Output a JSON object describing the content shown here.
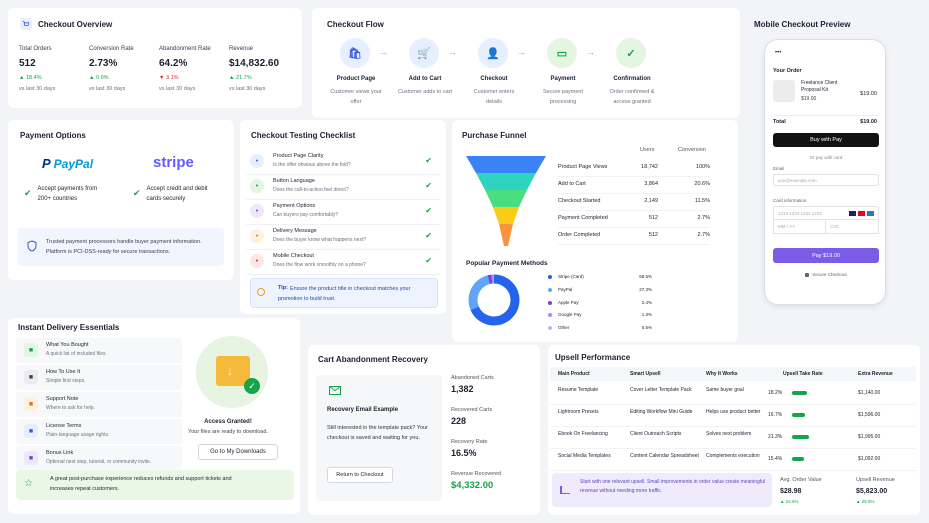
{
  "overview": {
    "title": "Checkout Overview",
    "stats": [
      {
        "label": "Total Orders",
        "value": "512",
        "delta": "18.4%",
        "dir": "up",
        "sub": "vs last 30 days"
      },
      {
        "label": "Conversion Rate",
        "value": "2.73%",
        "delta": "0.6%",
        "dir": "up",
        "sub": "vs last 30 days"
      },
      {
        "label": "Abandonment Rate",
        "value": "64.2%",
        "delta": "3.1%",
        "dir": "down",
        "sub": "vs last 30 days"
      },
      {
        "label": "Revenue",
        "value": "$14,832.60",
        "delta": "21.7%",
        "dir": "up",
        "sub": "vs last 30 days"
      }
    ]
  },
  "flow": {
    "title": "Checkout Flow",
    "steps": [
      {
        "title": "Product Page",
        "desc": "Customer views your offer"
      },
      {
        "title": "Add to Cart",
        "desc": "Customer adds to cart"
      },
      {
        "title": "Checkout",
        "desc": "Customer enters details"
      },
      {
        "title": "Payment",
        "desc": "Secure payment processing"
      },
      {
        "title": "Confirmation",
        "desc": "Order confirmed & access granted"
      }
    ]
  },
  "mobile": {
    "title": "Mobile Checkout Preview",
    "your_order": "Your Order",
    "item_name": "Freelance Client Proposal Kit",
    "item_price_small": "$19.00",
    "item_price": "$19.00",
    "total_label": "Total",
    "total_value": "$19.00",
    "applepay": "Buy with  Pay",
    "or_pay": "Or pay with card",
    "email_label": "Email",
    "email_placeholder": "you@example.com",
    "card_label": "Card information",
    "card_placeholder": "1234 1234 1234 1234",
    "mm": "MM / YY",
    "cvc": "CVC",
    "pay_button": "Pay $19.00",
    "secure": "Secure Checkout"
  },
  "payment": {
    "title": "Payment Options",
    "paypal": "PayPal",
    "paypal_desc": "Accept payments from 200+ countries",
    "stripe": "stripe",
    "stripe_desc": "Accept credit and debit cards securely",
    "note": "Trusted payment processors handle buyer payment information. Platform is PCI-DSS-ready for secure transactions."
  },
  "checklist": {
    "title": "Checkout Testing Checklist",
    "items": [
      {
        "title": "Product Page Clarity",
        "desc": "Is the offer obvious above the fold?"
      },
      {
        "title": "Button Language",
        "desc": "Does the call-to-action feel direct?"
      },
      {
        "title": "Payment Options",
        "desc": "Can buyers pay comfortably?"
      },
      {
        "title": "Delivery Message",
        "desc": "Does the buyer know what happens next?"
      },
      {
        "title": "Mobile Checkout",
        "desc": "Does the flow work smoothly on a phone?"
      }
    ],
    "tip_label": "Tip:",
    "tip": "Ensure the product title in checkout matches your promotion to build trust."
  },
  "funnel": {
    "title": "Purchase Funnel",
    "col_users": "Users",
    "col_conv": "Conversion",
    "rows": [
      {
        "label": "Product Page Views",
        "users": "18,742",
        "conv": "100%"
      },
      {
        "label": "Add to Cart",
        "users": "3,864",
        "conv": "20.6%"
      },
      {
        "label": "Checkout Started",
        "users": "2,149",
        "conv": "11.5%"
      },
      {
        "label": "Payment Completed",
        "users": "512",
        "conv": "2.7%"
      },
      {
        "label": "Order Completed",
        "users": "512",
        "conv": "2.7%"
      }
    ],
    "colors": [
      "#3b82f6",
      "#2dd4bf",
      "#4ade80",
      "#facc15",
      "#fb923c"
    ]
  },
  "methods": {
    "title": "Popular Payment Methods",
    "items": [
      {
        "label": "Stripe (Card)",
        "pct": "68.5%",
        "color": "#2563eb"
      },
      {
        "label": "PayPal",
        "pct": "27.3%",
        "color": "#60a5fa"
      },
      {
        "label": "Apple Pay",
        "pct": "2.4%",
        "color": "#7c3aed"
      },
      {
        "label": "Google Pay",
        "pct": "1.3%",
        "color": "#a78bfa"
      },
      {
        "label": "Other",
        "pct": "0.5%",
        "color": "#c4b5fd"
      }
    ]
  },
  "chart_data": {
    "type": "pie",
    "categories": [
      "Stripe (Card)",
      "PayPal",
      "Apple Pay",
      "Google Pay",
      "Other"
    ],
    "values": [
      68.5,
      27.3,
      2.4,
      1.3,
      0.5
    ],
    "title": "Popular Payment Methods"
  },
  "delivery": {
    "title": "Instant Delivery Essentials",
    "items": [
      {
        "title": "What You Bought",
        "desc": "A quick list of included files."
      },
      {
        "title": "How To Use It",
        "desc": "Simple first steps."
      },
      {
        "title": "Support Note",
        "desc": "Where to ask for help."
      },
      {
        "title": "License Terms",
        "desc": "Plain-language usage rights."
      },
      {
        "title": "Bonus Link",
        "desc": "Optional next step, tutorial, or community invite."
      }
    ],
    "access_title": "Access Granted!",
    "access_desc": "Your files are ready to download.",
    "download_btn": "Go to My Downloads",
    "footer": "A great post-purchase experience reduces refunds and support tickets and increases repeat customers."
  },
  "recovery": {
    "title": "Cart Abandonment Recovery",
    "email_title": "Recovery Email Example",
    "email_body": "Still interested in the template pack? Your checkout is saved and waiting for you.",
    "return_btn": "Return to Checkout",
    "stats": [
      {
        "label": "Abandoned Carts",
        "value": "1,382"
      },
      {
        "label": "Recovered Carts",
        "value": "228"
      },
      {
        "label": "Recovery Rate",
        "value": "16.5%"
      },
      {
        "label": "Revenue Recovered",
        "value": "$4,332.00"
      }
    ]
  },
  "upsell": {
    "title": "Upsell Performance",
    "headers": [
      "Main Product",
      "Smart Upsell",
      "Why It Works",
      "Upsell Take Rate",
      "Extra Revenue"
    ],
    "rows": [
      {
        "main": "Resume Template",
        "upsell": "Cover Letter Template Pack",
        "why": "Same buyer goal",
        "rate": "18.2%",
        "rate_val": 18.2,
        "rev": "$1,140.00"
      },
      {
        "main": "Lightroom Presets",
        "upsell": "Editing Workflow Mini Guide",
        "why": "Helps use product better",
        "rate": "16.7%",
        "rate_val": 16.7,
        "rev": "$1,596.00"
      },
      {
        "main": "Ebook On Freelancing",
        "upsell": "Client Outreach Scripts",
        "why": "Solves next problem",
        "rate": "21.3%",
        "rate_val": 21.3,
        "rev": "$1,995.00"
      },
      {
        "main": "Social Media Templates",
        "upsell": "Content Calendar Spreadsheet",
        "why": "Complements execution",
        "rate": "15.4%",
        "rate_val": 15.4,
        "rev": "$1,092.00"
      }
    ],
    "footer": "Start with one relevant upsell. Small improvements in order value create meaningful revenue without needing more traffic.",
    "aov_label": "Avg. Order Value",
    "aov": "$28.98",
    "aov_delta": "24.6%",
    "rev_label": "Upsell Revenue",
    "rev": "$5,823.00",
    "rev_delta": "29.8%"
  }
}
